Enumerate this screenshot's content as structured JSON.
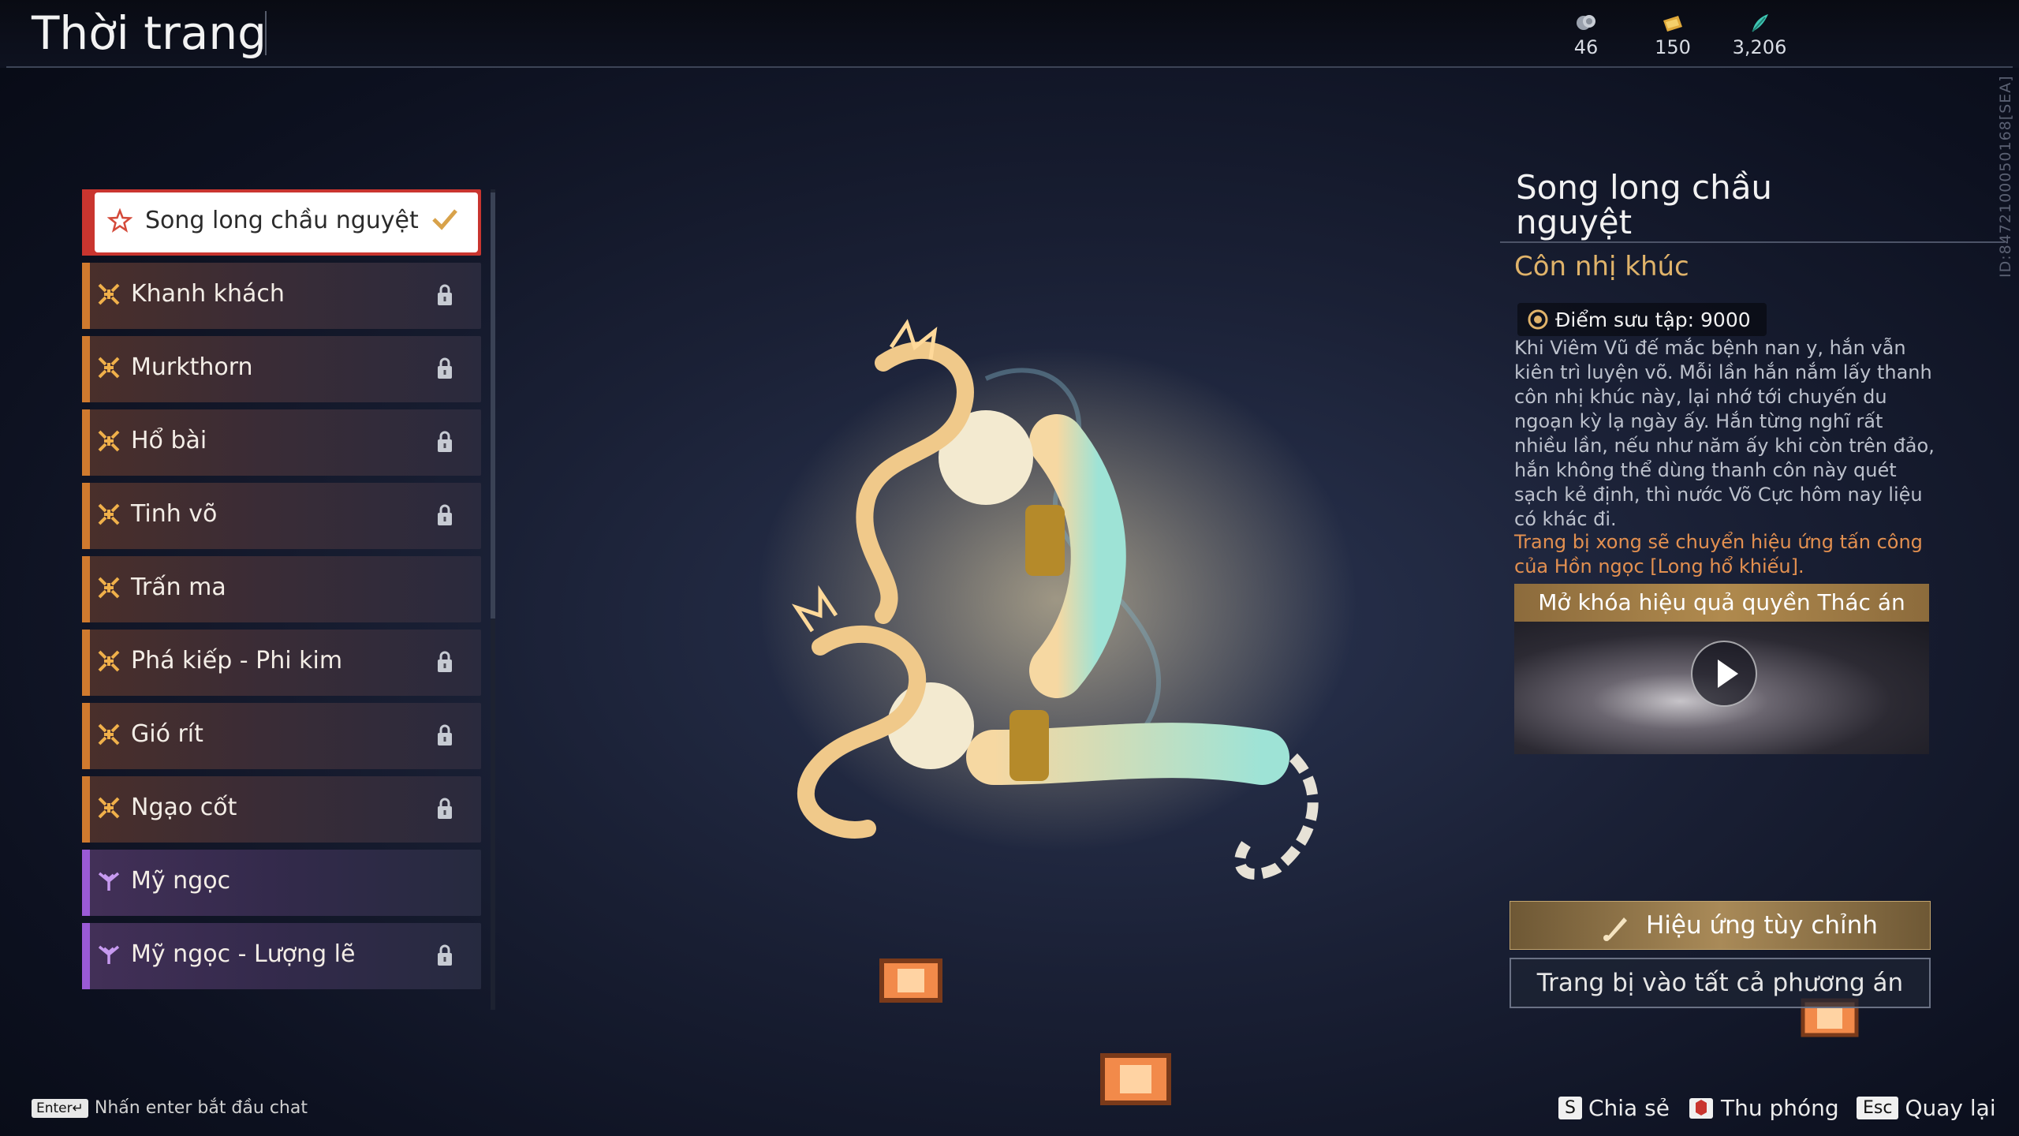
{
  "header": {
    "title": "Thời trang",
    "currencies": [
      {
        "icon": "coin-icon",
        "value": "46"
      },
      {
        "icon": "gold-ticket-icon",
        "value": "150"
      },
      {
        "icon": "jade-feather-icon",
        "value": "3,206"
      }
    ],
    "server_id": "ID:8472100050168[SEA]"
  },
  "list": {
    "items": [
      {
        "label": "Song long chầu nguyệt",
        "state": "selected",
        "rarity": "orange"
      },
      {
        "label": "Khanh khách",
        "state": "locked",
        "rarity": "orange"
      },
      {
        "label": "Murkthorn",
        "state": "locked",
        "rarity": "orange"
      },
      {
        "label": "Hổ bài",
        "state": "locked",
        "rarity": "orange"
      },
      {
        "label": "Tinh võ",
        "state": "locked",
        "rarity": "orange"
      },
      {
        "label": "Trấn ma",
        "state": "unlocked",
        "rarity": "orange"
      },
      {
        "label": "Phá kiếp - Phi kim",
        "state": "locked",
        "rarity": "orange"
      },
      {
        "label": "Gió rít",
        "state": "locked",
        "rarity": "orange"
      },
      {
        "label": "Ngạo cốt",
        "state": "locked",
        "rarity": "orange"
      },
      {
        "label": "Mỹ ngọc",
        "state": "unlocked",
        "rarity": "purple"
      },
      {
        "label": "Mỹ ngọc - Lượng lẽ",
        "state": "locked",
        "rarity": "purple"
      }
    ]
  },
  "detail": {
    "title": "Song long chầu nguyệt",
    "subtitle": "Côn nhị khúc",
    "points_label": "Điểm sưu tập: 9000",
    "description": "Khi Viêm Vũ đế mắc bệnh nan y, hắn vẫn kiên trì luyện võ. Mỗi lần hắn nắm lấy thanh côn nhị khúc này, lại nhớ tới chuyến du ngoạn kỳ lạ ngày ấy. Hắn từng nghĩ rất nhiều lần, nếu như năm ấy khi còn trên đảo, hắn không thể dùng thanh côn này quét sạch kẻ định, thì nước Võ Cực hôm nay liệu có khác đi.",
    "note": "Trang bị xong sẽ chuyển hiệu ứng tấn công của Hồn ngọc [Long hổ khiếu].",
    "video_title": "Mở khóa hiệu quả quyền Thác án",
    "effect_button": "Hiệu ứng tùy chỉnh",
    "equip_button": "Trang bị vào tất cả phương án"
  },
  "footer": {
    "chat_key": "Enter↵",
    "chat_hint": "Nhấn enter bắt đầu chat",
    "share_key": "S",
    "share_label": "Chia sẻ",
    "zoom_label": "Thu phóng",
    "back_key": "Esc",
    "back_label": "Quay lại"
  },
  "colors": {
    "selected": "#c9352f",
    "orange_rarity": "#d07a2e",
    "purple_rarity": "#9a5ad6",
    "gold_text": "#e0b36a",
    "note_text": "#e39050"
  }
}
